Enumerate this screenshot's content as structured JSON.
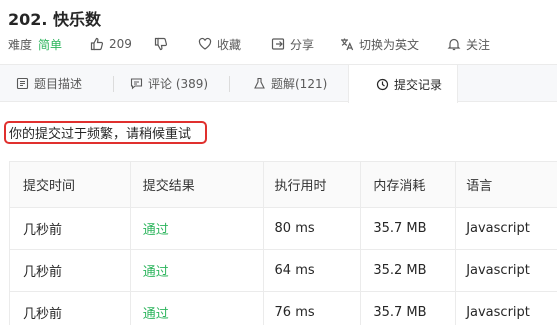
{
  "problem": {
    "title": "202. 快乐数",
    "difficulty_label": "难度",
    "difficulty": "简单",
    "likes": "209",
    "collect": "收藏",
    "share": "分享",
    "translate": "切换为英文",
    "follow": "关注"
  },
  "tabs": [
    {
      "label": "题目描述",
      "icon": "document-icon"
    },
    {
      "label": "评论 (389)",
      "icon": "comment-icon"
    },
    {
      "label": "题解(121)",
      "icon": "flask-icon"
    },
    {
      "label": "提交记录",
      "icon": "clock-icon",
      "active": true
    }
  ],
  "warning": "你的提交过于频繁，请稍候重试",
  "table": {
    "headers": [
      "提交时间",
      "提交结果",
      "执行用时",
      "内存消耗",
      "语言"
    ],
    "rows": [
      [
        "几秒前",
        "通过",
        "80 ms",
        "35.7 MB",
        "Javascript"
      ],
      [
        "几秒前",
        "通过",
        "64 ms",
        "35.2 MB",
        "Javascript"
      ],
      [
        "几秒前",
        "通过",
        "76 ms",
        "35.7 MB",
        "Javascript"
      ]
    ]
  },
  "colors": {
    "easy": "#2db55d",
    "accepted": "#2db55d",
    "warning_border": "#e0302e",
    "tab_bar_bg": "#f7f8fa"
  }
}
